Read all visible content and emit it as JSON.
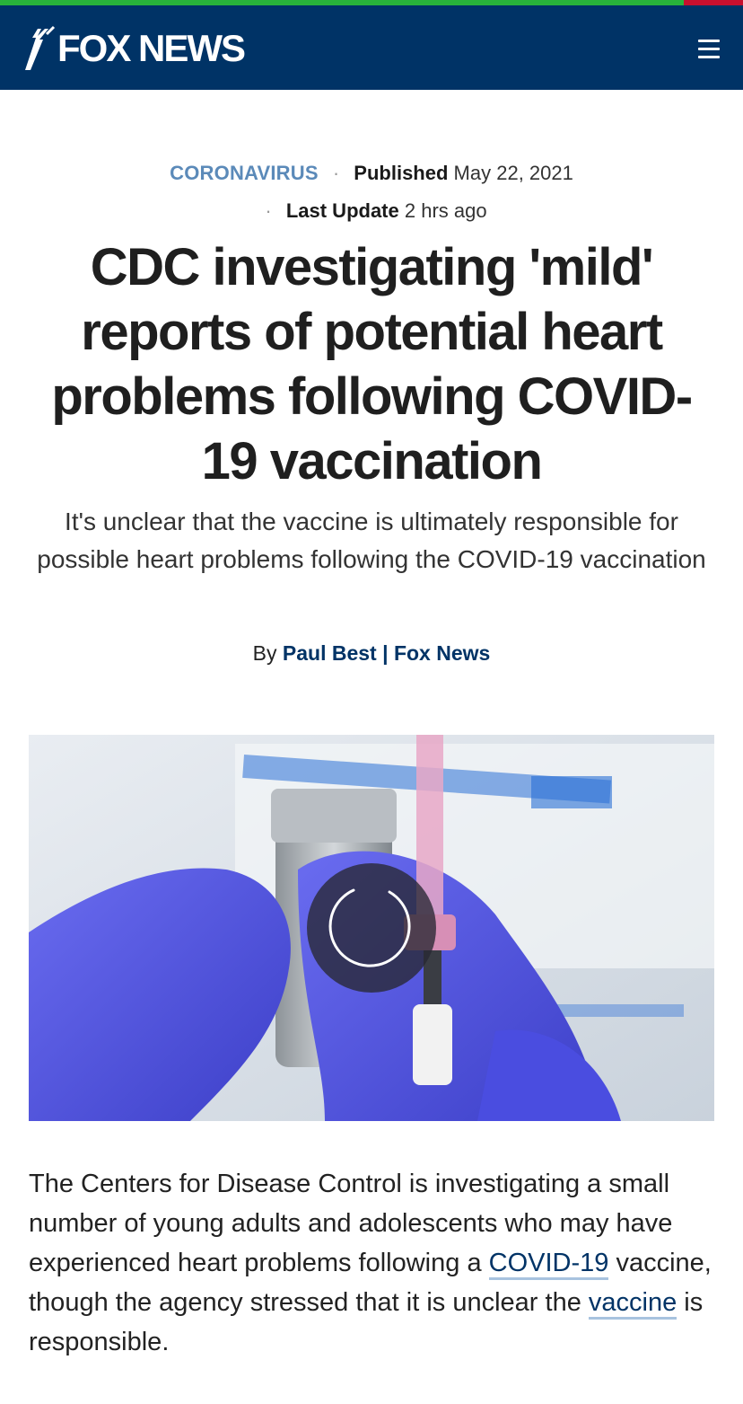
{
  "header": {
    "logo_text": "FOX NEWS",
    "menu_icon": "hamburger-menu-icon",
    "colors": {
      "bar": "#003366",
      "accent_green": "#28b33b",
      "accent_red": "#c8102e"
    }
  },
  "article": {
    "category": "CORONAVIRUS",
    "published_label": "Published",
    "published_date": "May 22, 2021",
    "updated_label": "Last Update",
    "updated_value": "2 hrs ago",
    "headline": "CDC investigating 'mild' reports of potential heart problems following COVID-19 vaccination",
    "subheadline": "It's unclear that the vaccine is ultimately responsible for possible heart problems following the COVID-19 vaccination",
    "byline_prefix": "By",
    "author": "Paul Best",
    "byline_separator": "|",
    "outlet": "Fox News",
    "body": {
      "part1": "The Centers for Disease Control is investigating a small number of young adults and adolescents who may have experienced heart problems following a ",
      "link1": "COVID-19",
      "part2": " vaccine, though the agency stressed that it is unclear the ",
      "link2": "vaccine",
      "part3": " is responsible."
    }
  },
  "media": {
    "loading_icon": "loading-spinner-icon"
  }
}
